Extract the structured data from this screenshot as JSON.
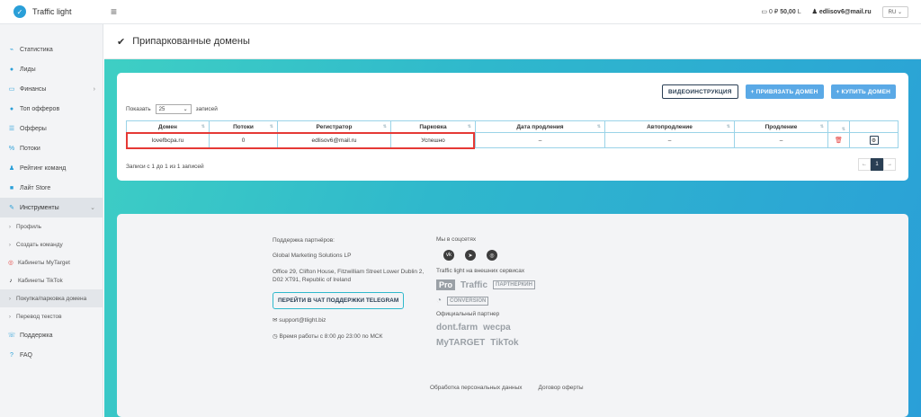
{
  "brand": {
    "name": "Traffic light"
  },
  "topbar": {
    "balance_label": "0 ₽",
    "balance_value": "50,00",
    "currency_icon": "L",
    "user": "edlisov6@mail.ru",
    "lang": "RU"
  },
  "sidebar": {
    "items": [
      {
        "label": "Статистика",
        "icon": "chart-icon"
      },
      {
        "label": "Лиды",
        "icon": "check-circle-icon"
      },
      {
        "label": "Финансы",
        "icon": "wallet-icon"
      },
      {
        "label": "Топ офферов",
        "icon": "dot-icon"
      },
      {
        "label": "Офферы",
        "icon": "list-icon"
      },
      {
        "label": "Потоки",
        "icon": "flow-icon"
      },
      {
        "label": "Рейтинг команд",
        "icon": "team-icon"
      },
      {
        "label": "Лайт Store",
        "icon": "store-icon"
      },
      {
        "label": "Инструменты",
        "icon": "wrench-icon"
      }
    ],
    "sub": [
      "Профиль",
      "Создать команду",
      "Кабинеты MyTarget",
      "Кабинеты TikTok",
      "Покупка/парковка домена",
      "Перевод текстов"
    ],
    "bottom": [
      "Поддержка",
      "FAQ"
    ]
  },
  "page": {
    "title": "Припаркованные домены"
  },
  "buttons": {
    "video": "ВИДЕОИНСТРУКЦИЯ",
    "attach": "+ ПРИВЯЗАТЬ ДОМЕН",
    "buy": "+ КУПИТЬ ДОМЕН"
  },
  "table": {
    "show": "Показать",
    "entries": "записей",
    "page_size": "25",
    "headers": [
      "Домен",
      "Потоки",
      "Регистратор",
      "Парковка",
      "Дата продления",
      "Автопродление",
      "Продление",
      "",
      ""
    ],
    "rows": [
      {
        "domain": "lovefbcpa.ru",
        "flows": "0",
        "registrar": "edlisov6@mail.ru",
        "parking": "Успешно",
        "renew_date": "–",
        "autorenew": "–",
        "renew": "–"
      }
    ],
    "records": "Записи с 1 до 1 из 1 записей",
    "pager": {
      "prev": "←",
      "page": "1",
      "next": "→"
    }
  },
  "footer": {
    "support_title": "Поддержка партнёров:",
    "company": "Global Marketing Solutions LP",
    "address": "Office 29, Clifton House, Fitzwilliam Street Lower Dublin 2, D02 XT91, Republic of Ireland",
    "telegram_btn": "ПЕРЕЙТИ В ЧАТ ПОДДЕРЖКИ TELEGRAM",
    "email": "support@tlight.biz",
    "hours": "Время работы с 8:00 до 23:00 по МСК",
    "social_title": "Мы в соцсетях",
    "external_title": "Traffic light на внешних сервисах",
    "partners": [
      "Pro",
      "Traffic",
      "ПАРТНЕРКИН",
      "CONVERSION"
    ],
    "official_title": "Официальный партнер",
    "official": [
      "dont.farm",
      "wecpa",
      "MyTARGET",
      "TikTok"
    ],
    "link_privacy": "Обработка персональных данных",
    "link_offer": "Договор оферты"
  }
}
